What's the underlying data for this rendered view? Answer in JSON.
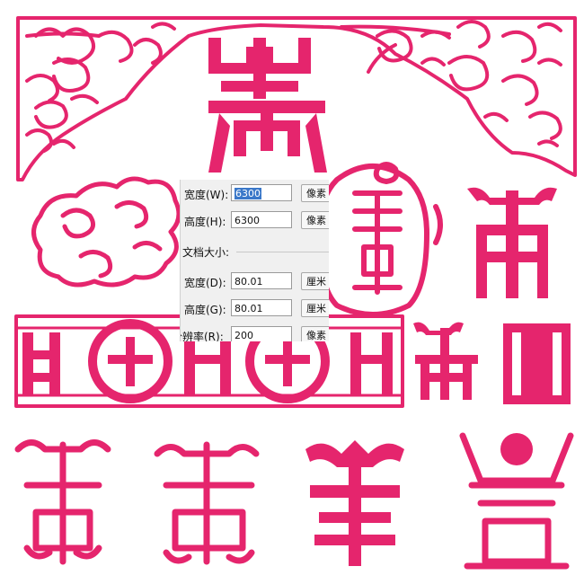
{
  "colors": {
    "ornament": "#e5256d",
    "background": "#ffffff",
    "panel": "#f0f0f0",
    "selection": "#3b78c9"
  },
  "dialog": {
    "width": {
      "label": "宽度(W):",
      "value": "6300",
      "unit": "像素"
    },
    "height": {
      "label": "高度(H):",
      "value": "6300",
      "unit": "像素"
    },
    "doc_size_label": "文档大小:",
    "doc_width": {
      "label": "宽度(D):",
      "value": "80.01",
      "unit": "厘米"
    },
    "doc_height": {
      "label": "高度(G):",
      "value": "80.01",
      "unit": "厘米"
    },
    "resolution": {
      "label": "分辨率(R):",
      "value": "200",
      "unit": "像素"
    }
  },
  "artwork": {
    "icons": [
      "cloud-corner-ornament",
      "shou-character-ornament",
      "cloud-ornament",
      "border-band-ornament"
    ]
  }
}
